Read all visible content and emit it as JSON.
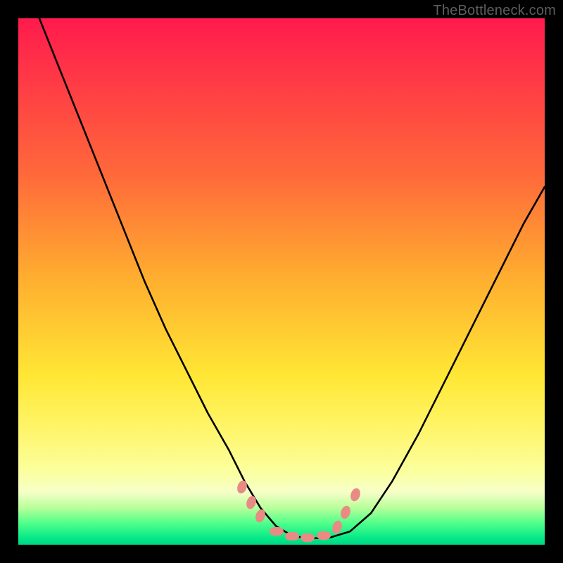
{
  "watermark": "TheBottleneck.com",
  "chart_data": {
    "type": "line",
    "title": "",
    "xlabel": "",
    "ylabel": "",
    "xlim": [
      0,
      100
    ],
    "ylim": [
      0,
      100
    ],
    "grid": false,
    "series": [
      {
        "name": "curve",
        "color": "#000000",
        "x": [
          4,
          8,
          12,
          16,
          20,
          24,
          28,
          32,
          36,
          40,
          43,
          46,
          49,
          52,
          55,
          59,
          63,
          67,
          71,
          76,
          82,
          89,
          96,
          100
        ],
        "y": [
          100,
          90,
          80,
          70,
          60,
          50,
          41,
          33,
          25,
          18,
          12,
          7,
          3.5,
          1.7,
          1.2,
          1.3,
          2.5,
          6,
          12,
          21,
          33,
          47,
          61,
          68
        ]
      }
    ],
    "markers": {
      "color": "#e98b84",
      "x": [
        42.5,
        44.3,
        46.0,
        49.0,
        52.0,
        55.0,
        58.0,
        60.5,
        62.2,
        64.0
      ],
      "y": [
        11.0,
        8.0,
        5.5,
        2.6,
        1.6,
        1.4,
        1.8,
        3.4,
        6.2,
        9.5
      ]
    },
    "background_gradient": {
      "stops": [
        {
          "pos": 0.0,
          "color": "#ff1a4d"
        },
        {
          "pos": 0.5,
          "color": "#ffb02f"
        },
        {
          "pos": 0.78,
          "color": "#fff56a"
        },
        {
          "pos": 0.93,
          "color": "#b8ff9a"
        },
        {
          "pos": 1.0,
          "color": "#00d682"
        }
      ]
    }
  }
}
